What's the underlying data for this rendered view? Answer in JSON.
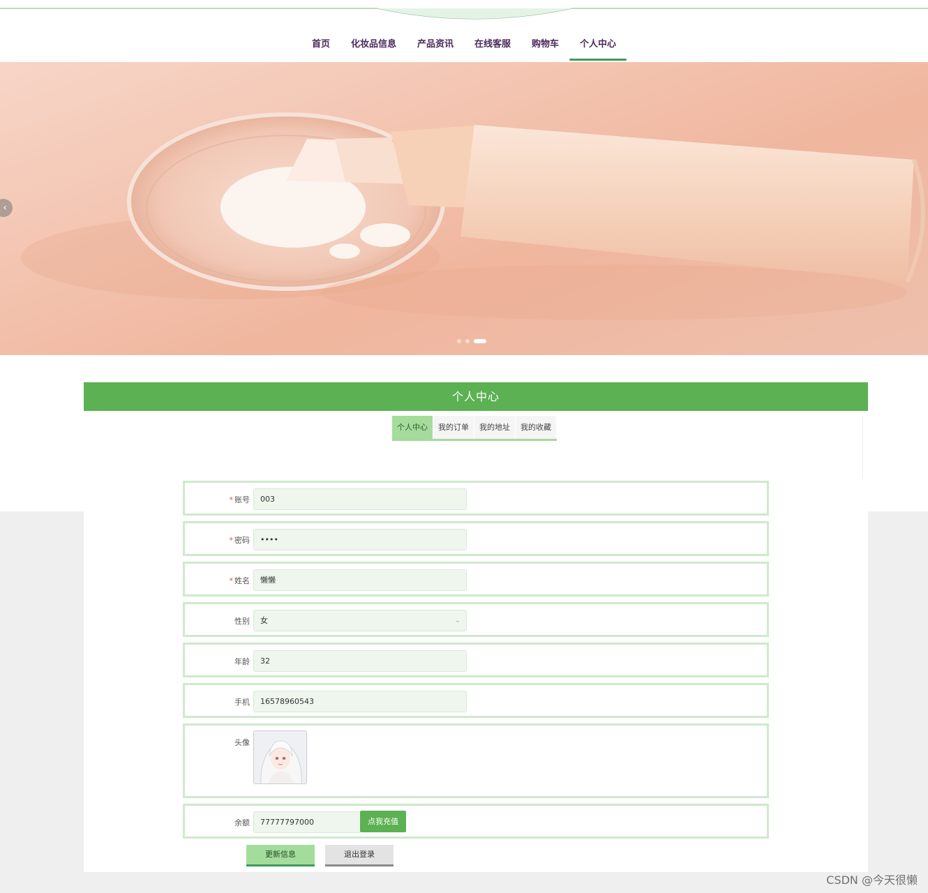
{
  "nav": {
    "items": [
      {
        "label": "首页"
      },
      {
        "label": "化妆品信息"
      },
      {
        "label": "产品资讯"
      },
      {
        "label": "在线客服"
      },
      {
        "label": "购物车"
      },
      {
        "label": "个人中心"
      }
    ],
    "active_index": 5
  },
  "banner": {
    "prev_glyph": "‹",
    "active_dot": 2
  },
  "panel": {
    "title": "个人中心",
    "tabs": [
      {
        "label": "个人中心"
      },
      {
        "label": "我的订单"
      },
      {
        "label": "我的地址"
      },
      {
        "label": "我的收藏"
      }
    ],
    "active_tab": 0
  },
  "form": {
    "account": {
      "label": "账号",
      "required_mark": "*",
      "value": "003"
    },
    "password": {
      "label": "密码",
      "required_mark": "*",
      "value": "••••"
    },
    "name": {
      "label": "姓名",
      "required_mark": "*",
      "value": "懒懒"
    },
    "gender": {
      "label": "性别",
      "value": "女"
    },
    "age": {
      "label": "年龄",
      "value": "32"
    },
    "phone": {
      "label": "手机",
      "value": "16578960543"
    },
    "avatar": {
      "label": "头像"
    },
    "balance": {
      "label": "余额",
      "value": "77777797000",
      "recharge_label": "点我充值"
    }
  },
  "actions": {
    "update_label": "更新信息",
    "logout_label": "退出登录"
  },
  "watermark": "CSDN @今天很懒",
  "colors": {
    "accent_green": "#5cb152",
    "tab_active_green": "#a4dc9c",
    "nav_text": "#4a2a5a",
    "field_bg": "#eef6ee",
    "row_border": "#cfe9cc",
    "required_red": "#e24b4b"
  }
}
